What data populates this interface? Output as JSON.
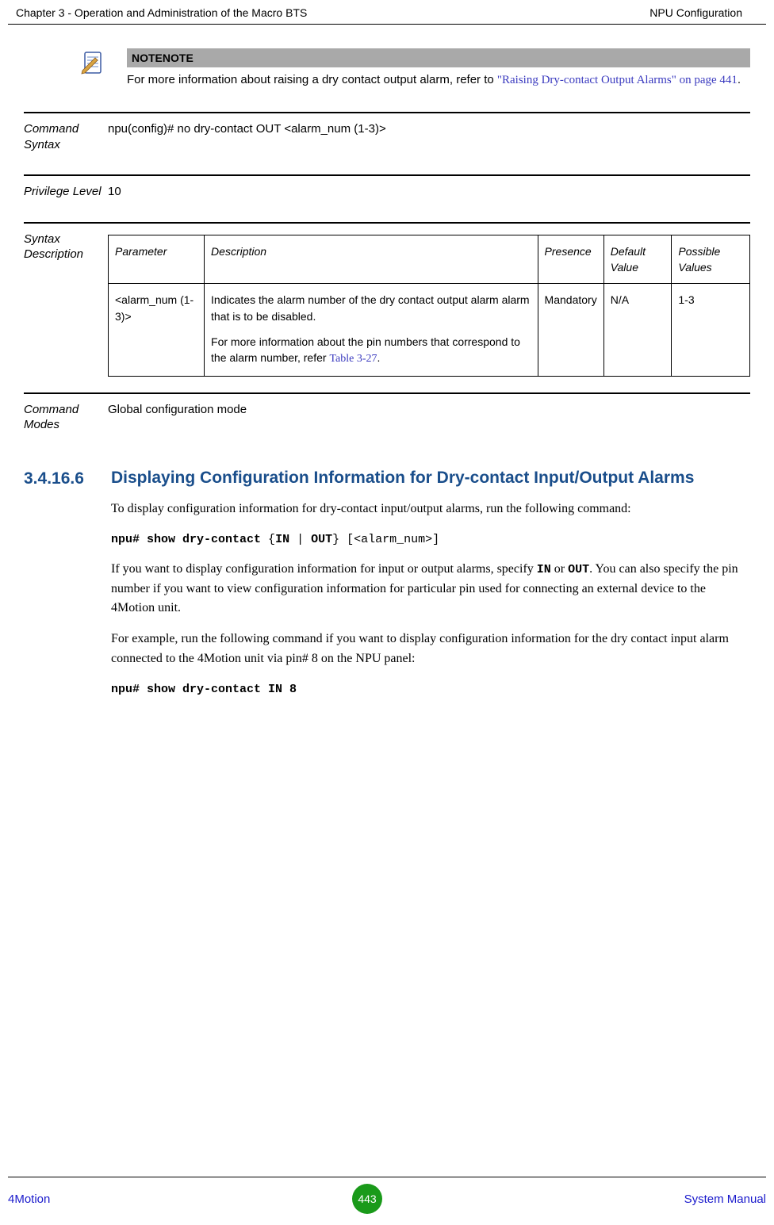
{
  "header": {
    "left": "Chapter 3 - Operation and Administration of the Macro BTS",
    "right": "NPU Configuration"
  },
  "note": {
    "label": "NOTENOTE",
    "text_prefix": "For more information about raising a dry contact output alarm, refer to ",
    "link_text": "\"Raising Dry-contact Output Alarms\" on page 441",
    "text_suffix": "."
  },
  "defs": {
    "command_syntax": {
      "label": "Command Syntax",
      "value": "npu(config)# no dry-contact OUT <alarm_num (1-3)>"
    },
    "privilege_level": {
      "label": "Privilege Level",
      "value": "10"
    },
    "syntax_description": {
      "label": "Syntax Description"
    },
    "command_modes": {
      "label": "Command Modes",
      "value": "Global configuration mode"
    }
  },
  "syntax_table": {
    "headers": {
      "parameter": "Parameter",
      "description": "Description",
      "presence": "Presence",
      "default_value": "Default Value",
      "possible_values": "Possible Values"
    },
    "row": {
      "parameter": "<alarm_num (1-3)>",
      "desc_p1": "Indicates the alarm number of the dry contact output alarm alarm that is to be disabled.",
      "desc_p2_prefix": "For more information about the pin numbers that correspond to the alarm number, refer ",
      "desc_p2_link": "Table 3-27",
      "desc_p2_suffix": ".",
      "presence": "Mandatory",
      "default_value": "N/A",
      "possible_values": "1-3"
    }
  },
  "section": {
    "number": "3.4.16.6",
    "title": "Displaying Configuration Information for Dry-contact Input/Output Alarms",
    "p1": "To display configuration information for dry-contact input/output alarms, run the following command:",
    "cmd1_bold": "npu# show dry-contact ",
    "cmd1_rest": "{IN | OUT} [<alarm_num>]",
    "cmd1_in": "IN",
    "cmd1_out": "OUT",
    "p2_a": "If you want to display configuration information for input or output alarms, specify ",
    "p2_b": " or ",
    "p2_c": ". You can also specify the pin number if you want to view configuration information for particular pin used for connecting an external device to the 4Motion unit.",
    "p3": "For example, run the following command if you want to display configuration information for the dry contact input alarm connected to the 4Motion unit via pin# 8 on the NPU panel:",
    "cmd2": "npu# show dry-contact IN 8"
  },
  "footer": {
    "left": "4Motion",
    "page": "443",
    "right": "System Manual"
  }
}
